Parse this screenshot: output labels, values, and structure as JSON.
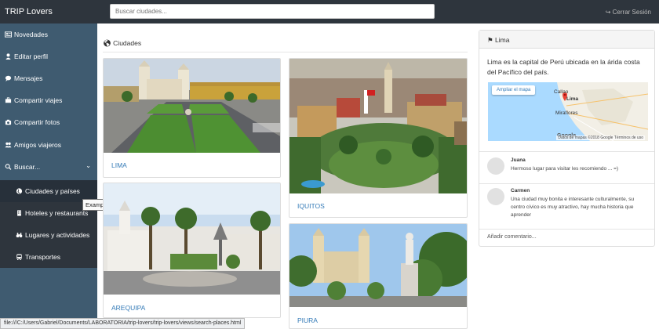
{
  "header": {
    "brand": "TRIP Lovers",
    "search_placeholder": "Buscar ciudades...",
    "logout_label": "Cerrar Sesión",
    "logout_icon": "sign-out-icon"
  },
  "sidebar": {
    "items": [
      {
        "label": "Novedades",
        "icon": "newspaper-icon"
      },
      {
        "label": "Editar perfil",
        "icon": "user-icon"
      },
      {
        "label": "Mensajes",
        "icon": "chat-icon"
      },
      {
        "label": "Compartir viajes",
        "icon": "briefcase-icon"
      },
      {
        "label": "Compartir fotos",
        "icon": "camera-icon"
      },
      {
        "label": "Amigos viajeros",
        "icon": "users-icon"
      },
      {
        "label": "Buscar...",
        "icon": "search-icon"
      }
    ],
    "subitems": [
      {
        "label": "Ciudades y países",
        "icon": "globe-icon"
      },
      {
        "label": "Hoteles y restaurants",
        "icon": "building-icon"
      },
      {
        "label": "Lugares y actividades",
        "icon": "binoculars-icon"
      },
      {
        "label": "Transportes",
        "icon": "bus-icon"
      }
    ],
    "tooltip": "Example Pages"
  },
  "main": {
    "section_title": "Ciudades",
    "cities": [
      {
        "name": "LIMA"
      },
      {
        "name": "IQUITOS"
      },
      {
        "name": "AREQUIPA"
      },
      {
        "name": "PIURA"
      }
    ]
  },
  "panel": {
    "title": "Lima",
    "description": "Lima es la capital de Perú ubicada en la árida costa del Pacífico del país.",
    "map": {
      "button_label": "Ampliar el mapa",
      "city_label": "Lima",
      "place_labels": [
        "Callao",
        "Miraflores"
      ],
      "google_label": "Google",
      "footer": "Datos de mapas ©2018 Google   Términos de uso"
    },
    "comments": [
      {
        "author": "Juana",
        "text": "Hermoso lugar para visitar les recomiendo ... =)"
      },
      {
        "author": "Carmen",
        "text": "Una ciudad muy bonita e interesante culturalmente, su centro cívico es muy atractivo, hay mucha historia que aprender"
      }
    ],
    "add_comment": "Añadir comentario..."
  },
  "status_bar": "file:///C:/Users/Gabriel/Documents/LABORATORIA/trip-lovers/trip-lovers/views/search-places.html",
  "colors": {
    "topbar": "#2e353d",
    "sidebar": "#3f5b70",
    "submenu": "#2e353d",
    "link": "#337ab7"
  }
}
